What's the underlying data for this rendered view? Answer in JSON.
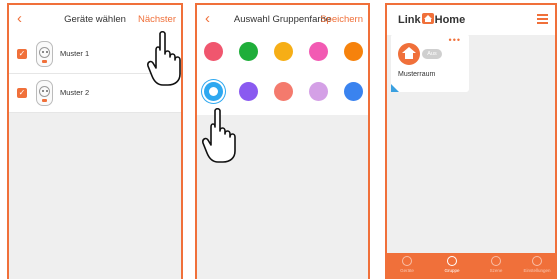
{
  "screen1": {
    "title": "Geräte wählen",
    "action": "Nächster",
    "back_icon": "chevron-left-icon",
    "devices": [
      {
        "label": "Muster 1",
        "checked": true
      },
      {
        "label": "Muster 2",
        "checked": true
      }
    ]
  },
  "screen2": {
    "title": "Auswahl Gruppenfarbe",
    "action": "Speichern",
    "back_icon": "chevron-left-icon",
    "colors": [
      "#f0566e",
      "#1fae3a",
      "#f6ae16",
      "#f25ab3",
      "#f6820c",
      "#2ea8f0",
      "#8a5af0",
      "#f47a6d",
      "#d4a0e6",
      "#3a83ef"
    ],
    "selected_index": 5
  },
  "screen3": {
    "logo": {
      "left": "Link",
      "right": "Home"
    },
    "room": {
      "name": "Musterraum",
      "badge": "Aus"
    },
    "tabs": [
      {
        "label": "Geräte",
        "active": false
      },
      {
        "label": "Gruppe",
        "active": true
      },
      {
        "label": "Szene",
        "active": false
      },
      {
        "label": "Einstellungen",
        "active": false
      }
    ]
  },
  "colors": {
    "accent": "#f0703a",
    "selected_ring": "#2ea8f0",
    "badge": "#cfcfcf"
  }
}
